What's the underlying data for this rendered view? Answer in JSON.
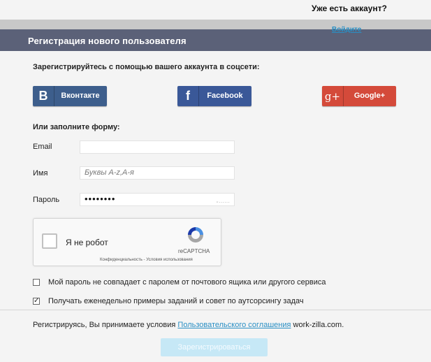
{
  "top": {
    "already_have_account": "Уже есть аккаунт?",
    "login_link": "Войдите"
  },
  "header": {
    "title": "Регистрация нового пользователя"
  },
  "social": {
    "title": "Зарегистрируйтесь с помощью вашего аккаунта в соцсети:",
    "buttons": [
      {
        "icon": "B",
        "label": "Вконтакте",
        "color": "#3d5e8c"
      },
      {
        "icon": "f",
        "label": "Facebook",
        "color": "#3a5898"
      },
      {
        "icon": "g+",
        "label": "Google+",
        "color": "#d44a3a"
      }
    ]
  },
  "form": {
    "title": "Или заполните форму:",
    "email": {
      "label": "Email",
      "value": ""
    },
    "name": {
      "label": "Имя",
      "placeholder": "Буквы А-z,А-я"
    },
    "password": {
      "label": "Пароль",
      "value": "••••••••"
    }
  },
  "captcha": {
    "label": "Я не робот",
    "brand": "reCAPTCHA",
    "links": "Конфиденциальность - Условия использования"
  },
  "checkboxes": [
    {
      "label": "Мой пароль не совпадает с паролем от почтового ящика или другого сервиса",
      "checked": false
    },
    {
      "label": "Получать еженедельно примеры заданий и совет по аутсорсингу задач",
      "checked": true
    }
  ],
  "terms": {
    "prefix": "Регистрируясь, Вы принимаете условия",
    "link": "Пользовательского соглашения",
    "suffix": "work-zilla.com."
  },
  "submit": {
    "label": "Зарегистрироваться"
  }
}
